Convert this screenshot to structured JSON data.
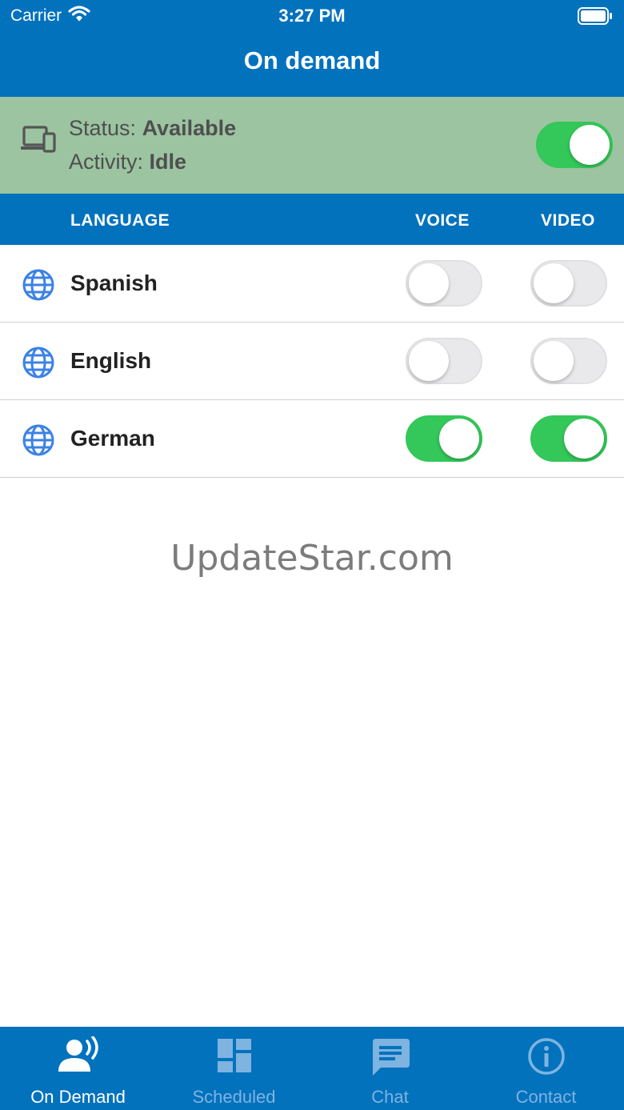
{
  "status_bar": {
    "carrier": "Carrier",
    "time": "3:27 PM"
  },
  "nav": {
    "title": "On demand"
  },
  "status_panel": {
    "status_label": "Status:",
    "status_value": "Available",
    "activity_label": "Activity:",
    "activity_value": "Idle",
    "availability_on": true
  },
  "table_header": {
    "language": "LANGUAGE",
    "voice": "VOICE",
    "video": "VIDEO"
  },
  "languages": [
    {
      "name": "Spanish",
      "voice": false,
      "video": false
    },
    {
      "name": "English",
      "voice": false,
      "video": false
    },
    {
      "name": "German",
      "voice": true,
      "video": true
    }
  ],
  "watermark": "UpdateStar.com",
  "tabs": [
    {
      "label": "On Demand",
      "icon": "voice-person-icon",
      "active": true
    },
    {
      "label": "Scheduled",
      "icon": "dashboard-icon",
      "active": false
    },
    {
      "label": "Chat",
      "icon": "chat-bubble-icon",
      "active": false
    },
    {
      "label": "Contact",
      "icon": "info-icon",
      "active": false
    }
  ],
  "colors": {
    "brand_blue": "#0272bd",
    "status_panel_green": "#9cc4a1",
    "toggle_on": "#34c759",
    "toggle_off": "#e9e9eb",
    "tab_inactive": "#7fb3e0",
    "globe_icon": "#3b82e6"
  }
}
